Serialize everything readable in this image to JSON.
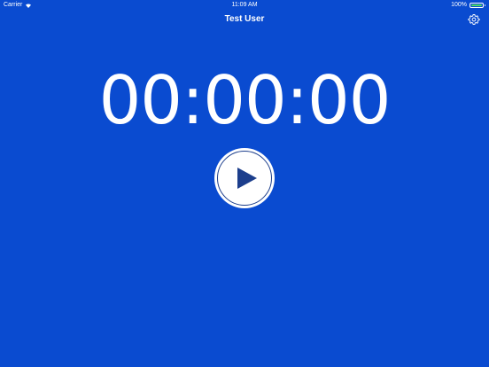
{
  "status_bar": {
    "carrier": "Carrier",
    "time": "11:09 AM",
    "battery_percent": "100%"
  },
  "header": {
    "title": "Test User"
  },
  "timer": {
    "display": "00:00:00"
  },
  "controls": {
    "play_icon": "play-icon",
    "settings_icon": "gear-icon"
  },
  "colors": {
    "background": "#0a4bd0",
    "play_symbol": "#1c3e8c",
    "battery": "#4cd964"
  }
}
